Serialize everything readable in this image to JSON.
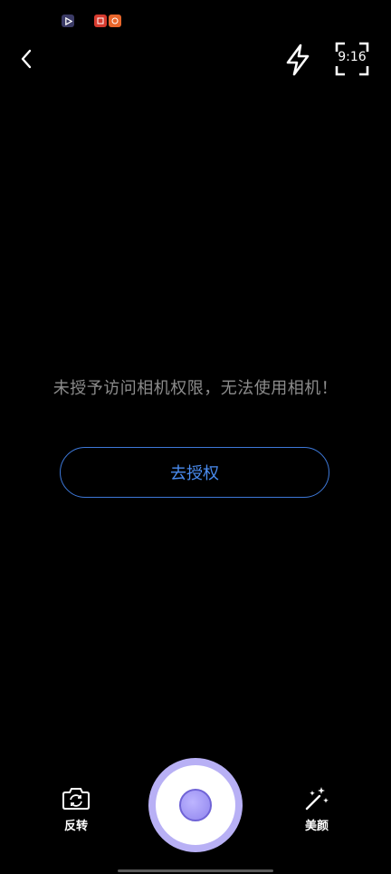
{
  "status_bar": {
    "icons": [
      "video-play-icon",
      "app-icon-red",
      "app-icon-orange"
    ]
  },
  "top_bar": {
    "back_icon": "chevron-left-icon",
    "flash_icon": "lightning-icon",
    "aspect_ratio_label": "9:16"
  },
  "main": {
    "permission_message": "未授予访问相机权限，无法使用相机！",
    "authorize_button_label": "去授权"
  },
  "bottom_controls": {
    "flip_label": "反转",
    "flip_icon": "camera-flip-icon",
    "beauty_label": "美颜",
    "beauty_icon": "magic-wand-icon",
    "shutter_icon": "shutter-button"
  },
  "colors": {
    "accent_blue": "#4a8cf0",
    "button_border": "#3d78d8",
    "shutter_outer": "#b8b0f5",
    "shutter_core": "#8f84ee",
    "message_text": "#8c8c8c",
    "background": "#000000"
  }
}
